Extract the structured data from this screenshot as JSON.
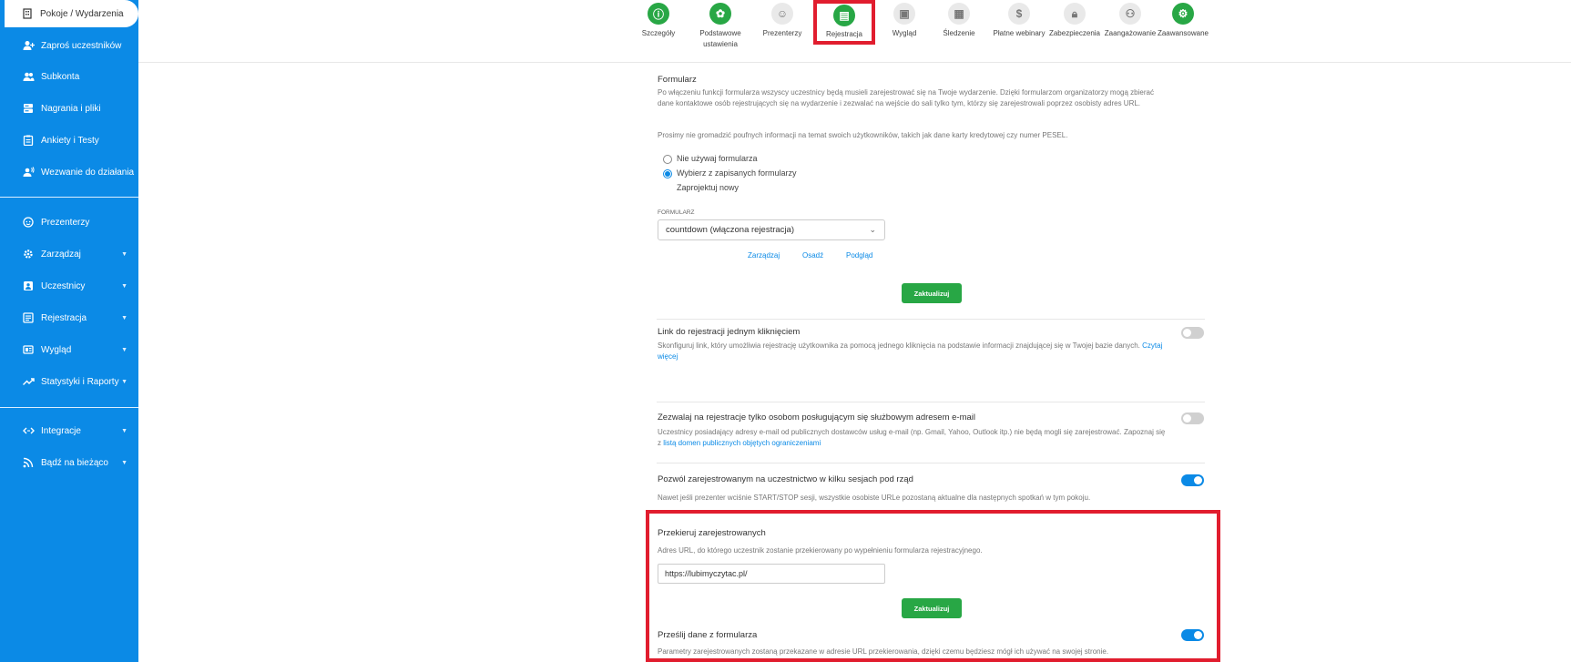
{
  "sidebar": {
    "items": [
      {
        "label": "Pokoje / Wydarzenia",
        "icon": "building-icon"
      },
      {
        "label": "Zaproś uczestników",
        "icon": "user-plus-icon"
      },
      {
        "label": "Subkonta",
        "icon": "users-icon"
      },
      {
        "label": "Nagrania i pliki",
        "icon": "storage-icon"
      },
      {
        "label": "Ankiety i Testy",
        "icon": "clipboard-icon"
      },
      {
        "label": "Wezwanie do działania",
        "icon": "user-broadcast-icon"
      },
      {
        "label": "Prezenterzy",
        "icon": "presenter-icon"
      },
      {
        "label": "Zarządzaj",
        "icon": "gear-icon"
      },
      {
        "label": "Uczestnicy",
        "icon": "person-card-icon"
      },
      {
        "label": "Rejestracja",
        "icon": "form-icon"
      },
      {
        "label": "Wygląd",
        "icon": "layout-icon"
      },
      {
        "label": "Statystyki i Raporty",
        "icon": "trend-icon"
      },
      {
        "label": "Integracje",
        "icon": "code-arrows-icon"
      },
      {
        "label": "Bądź na bieżąco",
        "icon": "rss-icon"
      }
    ]
  },
  "topnav": {
    "tabs": [
      {
        "label": "Szczegóły",
        "icon": "info-icon"
      },
      {
        "label": "Podstawowe ustawienia",
        "icon": "gear-icon"
      },
      {
        "label": "Prezenterzy",
        "icon": "presenter-icon"
      },
      {
        "label": "Rejestracja",
        "icon": "form-icon"
      },
      {
        "label": "Wygląd",
        "icon": "layout-icon"
      },
      {
        "label": "Śledzenie",
        "icon": "chart-icon"
      },
      {
        "label": "Płatne webinary",
        "icon": "dollar-icon"
      },
      {
        "label": "Zabezpieczenia",
        "icon": "lock-icon"
      },
      {
        "label": "Zaangażowanie",
        "icon": "people-icon"
      },
      {
        "label": "Zaawansowane",
        "icon": "settings-icon"
      }
    ]
  },
  "form": {
    "title": "Formularz",
    "desc1": "Po włączeniu funkcji formularza wszyscy uczestnicy będą musieli zarejestrować się na Twoje wydarzenie. Dzięki formularzom organizatorzy mogą zbierać dane kontaktowe osób rejestrujących się na wydarzenie i zezwalać na wejście do sali tylko tym, którzy się zarejestrowali poprzez osobisty adres URL.",
    "desc2": "Prosimy nie gromadzić poufnych informacji na temat swoich użytkowników, takich jak dane karty kredytowej czy numer PESEL.",
    "radio_none": "Nie używaj formularza",
    "radio_saved": "Wybierz z zapisanych formularzy",
    "design_new": "Zaprojektuj nowy",
    "select_label": "FORMULARZ",
    "select_value": "countdown (włączona rejestracja)",
    "manage": "Zarządzaj",
    "embed": "Osadź",
    "preview": "Podgląd",
    "update": "Zaktualizuj"
  },
  "oneclick": {
    "title": "Link do rejestracji jednym kliknięciem",
    "desc": "Skonfiguruj link, który umożliwia rejestrację użytkownika za pomocą jednego kliknięcia na podstawie informacji znajdującej się w Twojej bazie danych.",
    "more": "Czytaj więcej",
    "enabled": false
  },
  "business_email": {
    "title": "Zezwalaj na rejestracje tylko osobom posługującym się służbowym adresem e-mail",
    "desc": "Uczestnicy posiadający adresy e-mail od publicznych dostawców usług e-mail (np. Gmail, Yahoo, Outlook itp.) nie będą mogli się zarejestrować. Zapoznaj się z",
    "link": "listą domen publicznych objętych ograniczeniami",
    "enabled": false
  },
  "multi_session": {
    "title": "Pozwól zarejestrowanym na uczestnictwo w kilku sesjach pod rząd",
    "desc": "Nawet jeśli prezenter wciśnie START/STOP sesji, wszystkie osobiste URLe pozostaną aktualne dla następnych spotkań w tym pokoju.",
    "enabled": true
  },
  "redirect": {
    "title": "Przekieruj zarejestrowanych",
    "desc": "Adres URL, do którego uczestnik zostanie przekierowany po wypełnieniu formularza rejestracyjnego.",
    "url": "https://lubimyczytac.pl/",
    "update": "Zaktualizuj"
  },
  "pass_data": {
    "title": "Prześlij dane z formularza",
    "desc": "Parametry zarejestrowanych zostaną przekazane w adresie URL przekierowania, dzięki czemu będziesz mógł ich używać na swojej stronie.",
    "enabled": true
  },
  "colors": {
    "sidebar": "#0b8ae6",
    "accent_green": "#28a745",
    "highlight_red": "#e11d2e"
  }
}
